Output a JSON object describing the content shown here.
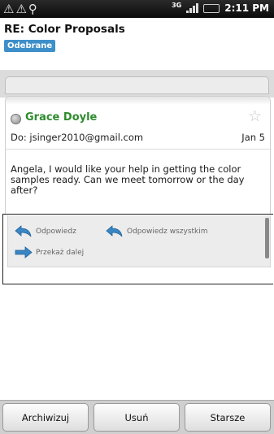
{
  "status_bar": {
    "icons": [
      "warning-icon",
      "warning-icon",
      "usb-icon"
    ],
    "network": "3G",
    "time": "2:11 PM"
  },
  "email": {
    "subject": "RE: Color Proposals",
    "label": "Odebrane",
    "sender": "Grace Doyle",
    "to": "Do: jsinger2010@gmail.com",
    "date": "Jan 5",
    "body": "Angela, I would like your help in getting the color samples ready. Can we meet tomorrow or the day after?"
  },
  "actions": {
    "reply": "Odpowiedz",
    "reply_all": "Odpowiedz wszystkim",
    "forward": "Przekaż dalej"
  },
  "bottom_bar": {
    "archive": "Archiwizuj",
    "delete": "Usuń",
    "older": "Starsze"
  },
  "colors": {
    "sender": "#2e8b2e",
    "label": "#3d8fc9",
    "reply_arrow": "#3a86c4"
  }
}
